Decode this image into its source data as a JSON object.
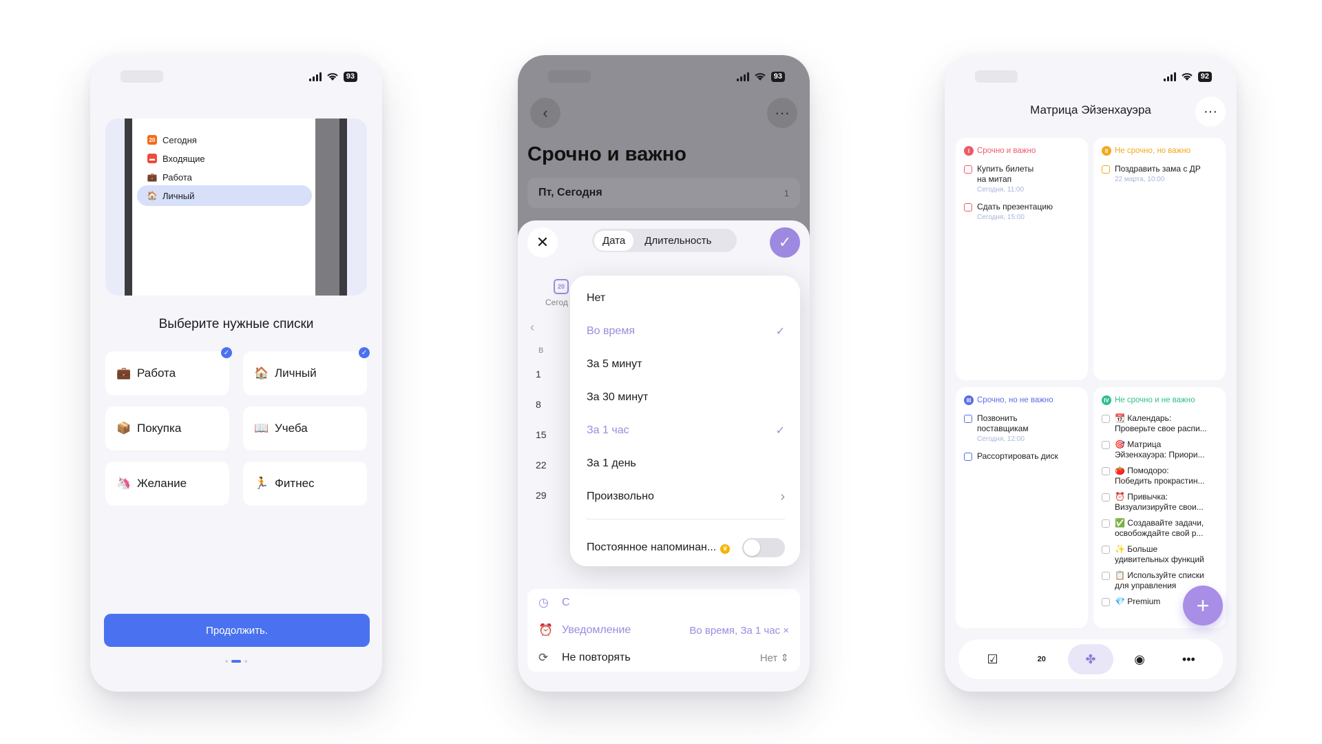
{
  "phone1": {
    "status": {
      "battery": "93"
    },
    "preview_items": [
      {
        "label": "Сегодня",
        "icon": "20",
        "icon_name": "calendar-icon",
        "color": "#f36b1c"
      },
      {
        "label": "Входящие",
        "icon": "▬",
        "icon_name": "inbox-icon",
        "color": "#f04a3a"
      },
      {
        "label": "Работа",
        "icon": "💼",
        "icon_name": "briefcase-icon",
        "color": ""
      },
      {
        "label": "Личный",
        "icon": "🏠",
        "icon_name": "house-icon",
        "color": ""
      }
    ],
    "title": "Выберите нужные списки",
    "cards": [
      {
        "label": "Работа",
        "emoji": "💼",
        "checked": true
      },
      {
        "label": "Личный",
        "emoji": "🏠",
        "checked": true
      },
      {
        "label": "Покупка",
        "emoji": "📦",
        "checked": false
      },
      {
        "label": "Учеба",
        "emoji": "📖",
        "checked": false
      },
      {
        "label": "Желание",
        "emoji": "🦄",
        "checked": false
      },
      {
        "label": "Фитнес",
        "emoji": "🏃",
        "checked": false
      }
    ],
    "continue_label": "Продолжить.",
    "accent": "#4a72f0"
  },
  "phone2": {
    "status": {
      "battery": "93"
    },
    "title": "Срочно и важно",
    "date_row": {
      "label": "Пт, Сегодня",
      "value": "1"
    },
    "tabs": {
      "date": "Дата",
      "duration": "Длительность"
    },
    "calendar": {
      "today_short": "Сегод",
      "weekday": "В",
      "days": [
        "1",
        "8",
        "15",
        "22",
        "29"
      ],
      "icon_day": "20"
    },
    "options": [
      {
        "label": "Нет",
        "checked": false
      },
      {
        "label": "Во время",
        "checked": true
      },
      {
        "label": "За 5 минут",
        "checked": false
      },
      {
        "label": "За 30 минут",
        "checked": false
      },
      {
        "label": "За 1 час",
        "checked": true
      },
      {
        "label": "За 1 день",
        "checked": false
      },
      {
        "label": "Произвольно",
        "checked": false
      }
    ],
    "persistent_label": "Постоянное напоминан...",
    "time_row_label": "С",
    "notification": {
      "label": "Уведомление",
      "value": "Во время, За 1 час"
    },
    "repeat": {
      "label": "Не повторять",
      "value": "Нет"
    },
    "accent": "#9d89e0"
  },
  "phone3": {
    "status": {
      "battery": "92"
    },
    "title": "Матрица Эйзенхауэра",
    "quadrants": [
      {
        "num": "I",
        "title": "Срочно и важно",
        "color": "#ee5a6a",
        "tasks": [
          {
            "text": "Купить билеты\nна митап",
            "sub": "Сегодня, 11:00"
          },
          {
            "text": "Сдать презентацию",
            "sub": "Сегодня, 15:00"
          }
        ]
      },
      {
        "num": "II",
        "title": "Не срочно, но важно",
        "color": "#f2a81e",
        "tasks": [
          {
            "text": "Поздравить зама с ДР",
            "sub": "22 марта, 10:00"
          }
        ]
      },
      {
        "num": "III",
        "title": "Срочно, но не важно",
        "color": "#5a6ee8",
        "tasks": [
          {
            "text": "Позвонить\nпоставщикам",
            "sub": "Сегодня, 12:00"
          },
          {
            "text": "Рассортировать диск",
            "sub": ""
          }
        ]
      },
      {
        "num": "IV",
        "title": "Не срочно и не важно",
        "color": "#2fbf8f",
        "tasks": [
          {
            "text": "📆 Календарь:\nПроверьте свое распи...",
            "sub": ""
          },
          {
            "text": "🎯 Матрица\nЭйзенхауэра: Приори...",
            "sub": ""
          },
          {
            "text": "🍅 Помодоро:\nПобедить прокрастин...",
            "sub": ""
          },
          {
            "text": "⏰ Привычка:\nВизуализируйте свои...",
            "sub": ""
          },
          {
            "text": "✅ Создавайте задачи,\nосвобождайте свой р...",
            "sub": ""
          },
          {
            "text": "✨ Больше\nудивительных функций",
            "sub": ""
          },
          {
            "text": "📋 Используйте списки\nдля управления",
            "sub": ""
          },
          {
            "text": "💎 Premium",
            "sub": ""
          }
        ]
      }
    ],
    "tabbar": [
      {
        "icon": "☑",
        "icon_name": "checkbox-icon",
        "active": false
      },
      {
        "icon": "20",
        "icon_name": "calendar-icon",
        "active": false
      },
      {
        "icon": "✤",
        "icon_name": "matrix-icon",
        "active": true
      },
      {
        "icon": "◉",
        "icon_name": "focus-icon",
        "active": false
      },
      {
        "icon": "•••",
        "icon_name": "more-icon",
        "active": false
      }
    ]
  }
}
